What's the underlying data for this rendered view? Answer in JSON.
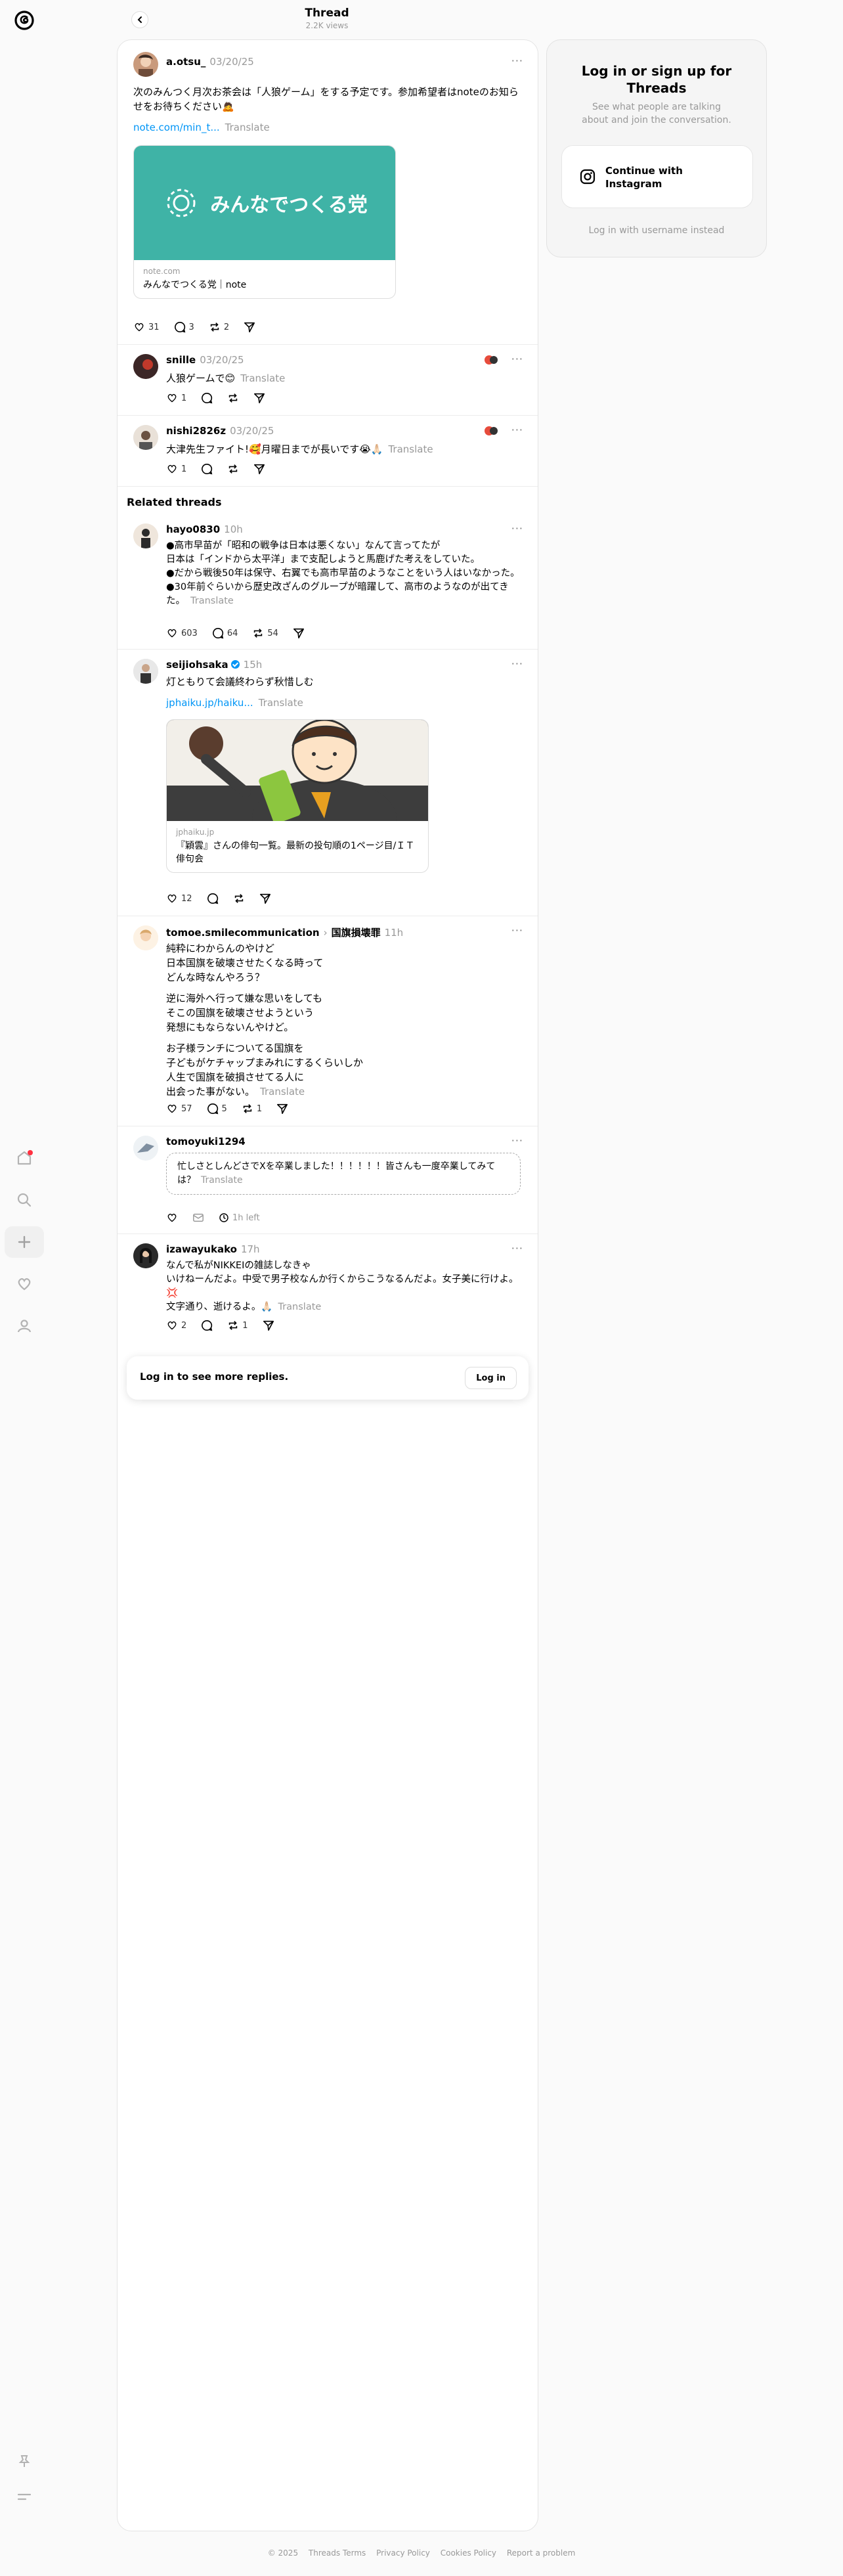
{
  "header": {
    "title": "Thread",
    "views": "2.2K views"
  },
  "sidebar": {
    "items": [
      {
        "icon": "home-icon"
      },
      {
        "icon": "search-icon"
      },
      {
        "icon": "plus-icon"
      },
      {
        "icon": "heart-icon"
      },
      {
        "icon": "profile-icon"
      },
      {
        "icon": "pin-icon"
      },
      {
        "icon": "menu-icon"
      }
    ]
  },
  "main_post": {
    "username": "a.otsu_",
    "time": "03/20/25",
    "text": "次のみんつく月次お茶会は「人狼ゲーム」をする予定です。参加希望者はnoteのお知らせをお待ちください🙇",
    "link": "note.com/min_t...",
    "translate": "Translate",
    "card": {
      "image_text": "みんなでつくる党",
      "domain": "note.com",
      "title": "みんなでつくる党｜note"
    },
    "likes": "31",
    "replies": "3",
    "reposts": "2"
  },
  "replies": [
    {
      "username": "snille",
      "time": "03/20/25",
      "text": "人狼ゲームで😊",
      "translate": "Translate",
      "likes": "1"
    },
    {
      "username": "nishi2826z",
      "time": "03/20/25",
      "text": "大津先生ファイト!🥰月曜日までが長いです😭🙏🏻",
      "translate": "Translate",
      "likes": "1"
    }
  ],
  "related_title": "Related threads",
  "related": [
    {
      "username": "hayo0830",
      "time": "10h",
      "lines": [
        "●高市早苗が「昭和の戦争は日本は悪くない」なんて言ってたが",
        "日本は「インドから太平洋」まで支配しようと馬鹿げた考えをしていた。",
        "●だから戦後50年は保守、右翼でも高市早苗のようなことをいう人はいなかった。",
        "●30年前ぐらいから歴史改ざんのグループが暗躍して、高市のようなのが出てきた。"
      ],
      "translate": "Translate",
      "likes": "603",
      "replies": "64",
      "reposts": "54"
    },
    {
      "username": "seijiohsaka",
      "time": "15h",
      "text": "灯ともりて会議終わらず秋惜しむ",
      "link": "jphaiku.jp/haiku...",
      "translate": "Translate",
      "card": {
        "domain": "jphaiku.jp",
        "title": "『穎雲』さんの俳句一覧。最新の投句順の1ページ目/ＩＴ俳句会"
      },
      "likes": "12"
    },
    {
      "username": "tomoe.smilecommunication",
      "topic": "国旗損壊罪",
      "time": "11h",
      "para1": [
        "純粋にわからんのやけど",
        "日本国旗を破壊させたくなる時って",
        "どんな時なんやろう？"
      ],
      "para2": [
        "逆に海外へ行って嫌な思いをしても",
        "そこの国旗を破壊させようという",
        "発想にもならないんやけど。"
      ],
      "para3": [
        "お子様ランチについてる国旗を",
        "子どもがケチャップまみれにするくらいしか",
        "人生で国旗を破損させてる人に",
        "出会った事がない。"
      ],
      "translate": "Translate",
      "likes": "57",
      "replies": "5",
      "reposts": "1"
    },
    {
      "username": "tomoyuki1294",
      "text": "忙しさとしんどさでXを卒業しました！！！！！！皆さんも一度卒業してみては？",
      "translate": "Translate",
      "time_left": "1h left"
    },
    {
      "username": "izawayukako",
      "time": "17h",
      "lines": [
        "なんで私がNIKKEIの雑誌しなきゃ",
        "いけねーんだよ。中受で男子校なんか行くからこうなるんだよ。女子美に行けよ。💢",
        "文字通り、逝けるよ。🙏🏻"
      ],
      "translate": "Translate",
      "likes": "2",
      "reposts": "1"
    }
  ],
  "login_bar": {
    "text": "Log in to see more replies.",
    "button": "Log in"
  },
  "side_panel": {
    "title": "Log in or sign up for Threads",
    "subtitle": "See what people are talking about and join the conversation.",
    "instagram_button": "Continue with Instagram",
    "alt_login": "Log in with username instead"
  },
  "footer": [
    "© 2025",
    "Threads Terms",
    "Privacy Policy",
    "Cookies Policy",
    "Report a problem"
  ]
}
